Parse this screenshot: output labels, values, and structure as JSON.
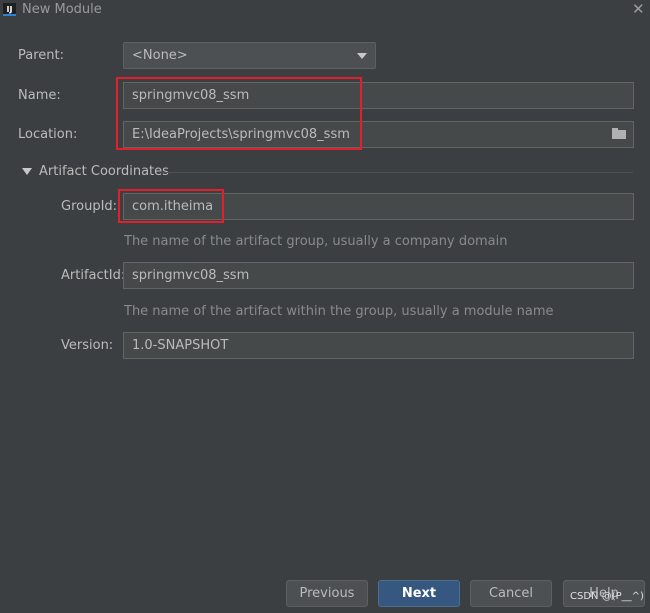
{
  "window": {
    "icon_text": "IJ",
    "title": "New Module",
    "close_glyph": "✕"
  },
  "form": {
    "parent": {
      "label": "Parent:",
      "value": "<None>"
    },
    "name": {
      "label": "Name:",
      "value": "springmvc08_ssm"
    },
    "location": {
      "label": "Location:",
      "value": "E:\\IdeaProjects\\springmvc08_ssm",
      "icon": "folder-icon"
    }
  },
  "artifact": {
    "section_title": "Artifact Coordinates",
    "group_id": {
      "label": "GroupId:",
      "value": "com.itheima",
      "hint": "The name of the artifact group, usually a company domain"
    },
    "artifact_id": {
      "label": "ArtifactId:",
      "value": "springmvc08_ssm",
      "hint": "The name of the artifact within the group, usually a module name"
    },
    "version": {
      "label": "Version:",
      "value": "1.0-SNAPSHOT"
    }
  },
  "buttons": {
    "previous": "Previous",
    "next": "Next",
    "cancel": "Cancel",
    "help": "Help"
  },
  "watermark": "CSDN @(P__^)",
  "colors": {
    "background": "#3c3f41",
    "field": "#45494a",
    "primary_button": "#365880",
    "annotation_red": "#e0202a"
  }
}
